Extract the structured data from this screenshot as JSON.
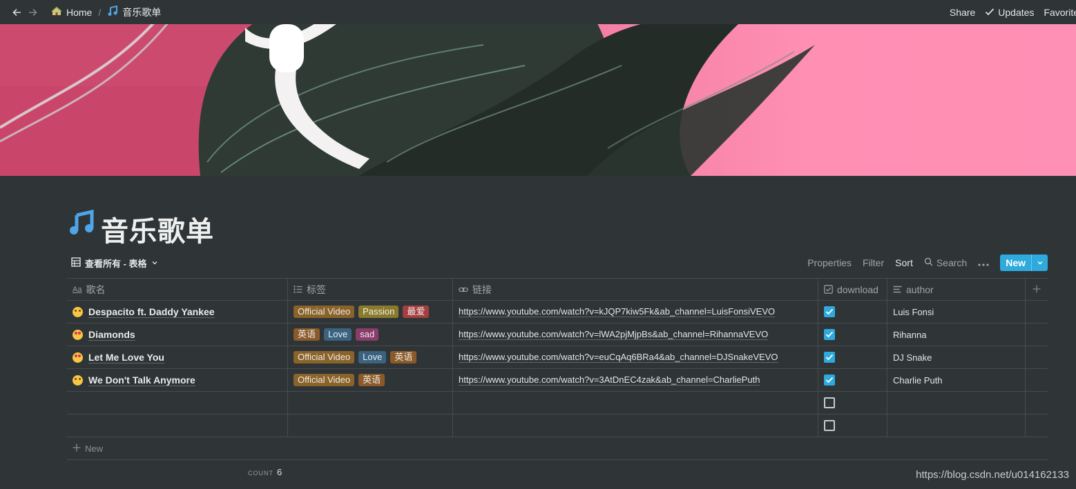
{
  "topbar": {
    "home_label": "Home",
    "page_label": "音乐歌单",
    "share_label": "Share",
    "updates_label": "Updates",
    "favorite_label": "Favorite"
  },
  "page": {
    "title": "音乐歌单"
  },
  "view": {
    "name": "查看所有 - 表格",
    "properties_label": "Properties",
    "filter_label": "Filter",
    "sort_label": "Sort",
    "search_label": "Search",
    "new_label": "New"
  },
  "columns": [
    "歌名",
    "标签",
    "链接",
    "download",
    "author"
  ],
  "rows": [
    {
      "name": "Despacito ft. Daddy Yankee",
      "tags": [
        {
          "label": "Official Video",
          "color": "#89632a"
        },
        {
          "label": "Passion",
          "color": "#8a7a2c"
        },
        {
          "label": "最爱",
          "color": "#a33f3f"
        }
      ],
      "link": "https://www.youtube.com/watch?v=kJQP7kiw5Fk&ab_channel=LuisFonsiVEVO",
      "download": true,
      "author": "Luis Fonsi"
    },
    {
      "name": "Diamonds",
      "tags": [
        {
          "label": "英语",
          "color": "#8a5a2a"
        },
        {
          "label": "Love",
          "color": "#3b6380"
        },
        {
          "label": "sad",
          "color": "#8a3d6a"
        }
      ],
      "link": "https://www.youtube.com/watch?v=lWA2pjMjpBs&ab_channel=RihannaVEVO",
      "download": true,
      "author": "Rihanna"
    },
    {
      "name": "Let Me Love You",
      "tags": [
        {
          "label": "Official Video",
          "color": "#89632a"
        },
        {
          "label": "Love",
          "color": "#3b6380"
        },
        {
          "label": "英语",
          "color": "#8a5a2a"
        }
      ],
      "link": "https://www.youtube.com/watch?v=euCqAq6BRa4&ab_channel=DJSnakeVEVO",
      "download": true,
      "author": "DJ Snake"
    },
    {
      "name": "We Don't Talk Anymore",
      "tags": [
        {
          "label": "Official Video",
          "color": "#89632a"
        },
        {
          "label": "英语",
          "color": "#8a5a2a"
        }
      ],
      "link": "https://www.youtube.com/watch?v=3AtDnEC4zak&ab_channel=CharliePuth",
      "download": true,
      "author": "Charlie Puth"
    },
    {
      "name": "",
      "tags": [],
      "link": "",
      "download": false,
      "author": ""
    },
    {
      "name": "",
      "tags": [],
      "link": "",
      "download": false,
      "author": ""
    }
  ],
  "footer": {
    "new_row_label": "New",
    "count_label": "COUNT",
    "count_value": "6"
  },
  "watermark": "https://blog.csdn.net/u014162133",
  "colors": {
    "accent": "#2eaadc",
    "background": "#2f3437"
  }
}
